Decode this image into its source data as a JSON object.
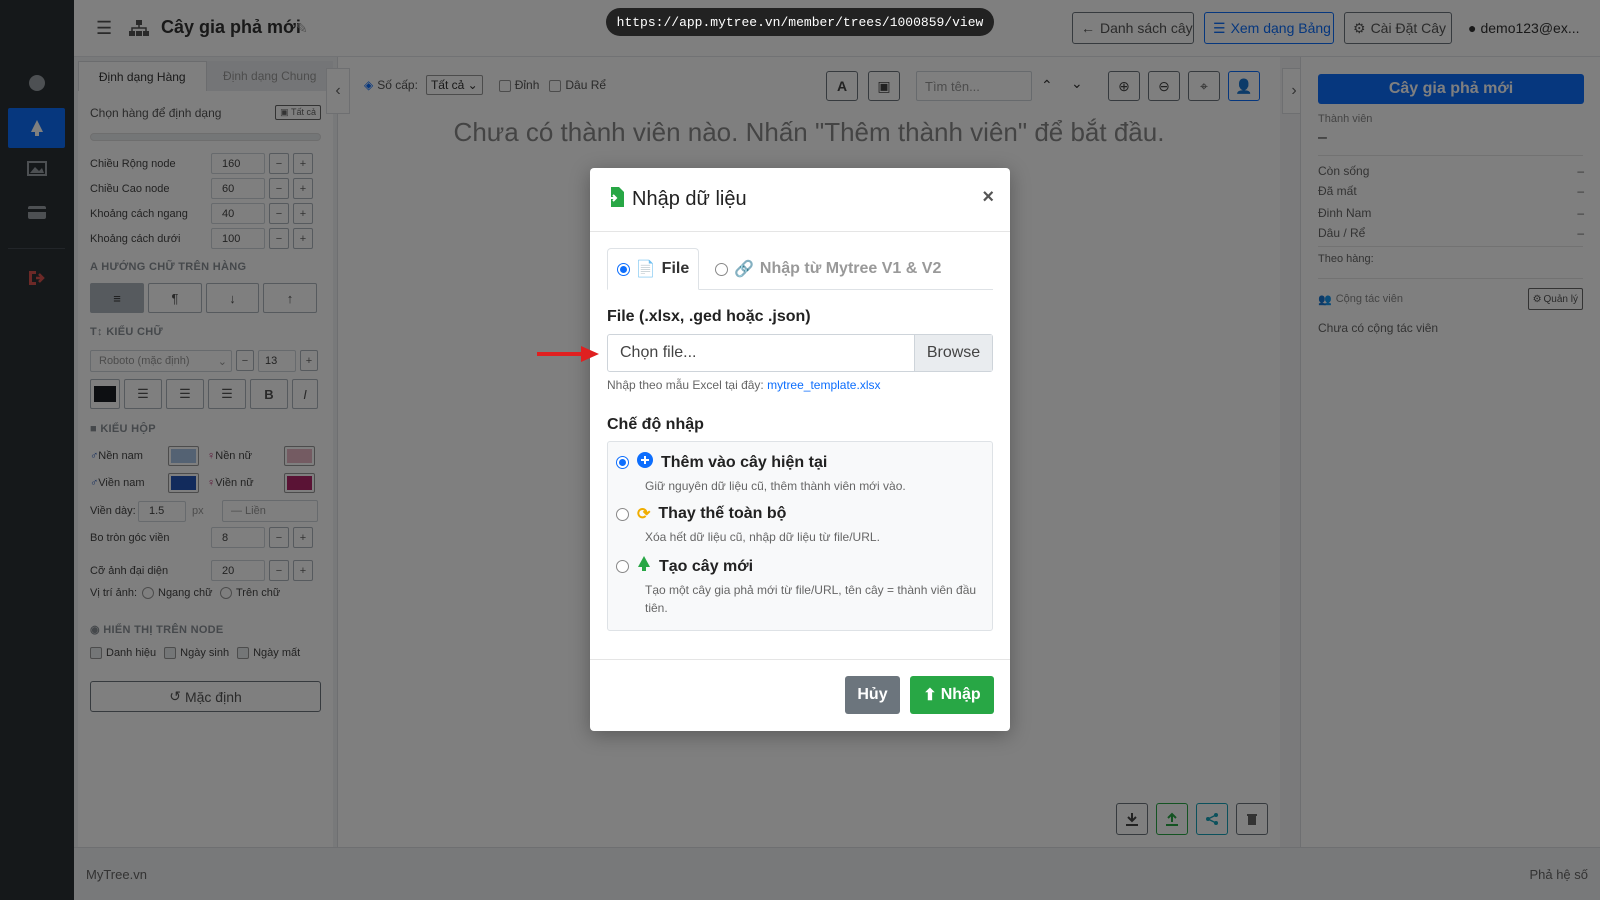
{
  "browser": {
    "url": "https://app.mytree.vn/member/trees/1000859/view"
  },
  "header": {
    "title": "Cây gia phả mới",
    "list_btn": "Danh sách cây",
    "table_btn": "Xem dạng Bảng",
    "settings_btn": "Cài Đặt Cây",
    "user": "demo123@ex..."
  },
  "left_panel": {
    "tab_row": "Định dạng Hàng",
    "tab_general": "Định dạng Chung",
    "select_row_label": "Chọn hàng để định dạng",
    "select_all_btn": "Tất cả",
    "fields": [
      {
        "label": "Chiều Rộng node",
        "value": "160"
      },
      {
        "label": "Chiều Cao node",
        "value": "60"
      },
      {
        "label": "Khoảng cách ngang",
        "value": "40"
      },
      {
        "label": "Khoảng cách dưới",
        "value": "100"
      }
    ],
    "text_dir_head": "HƯỚNG CHỮ TRÊN HÀNG",
    "font_head": "KIỂU CHỮ",
    "font_family": "Roboto (mặc định)",
    "font_size": "13",
    "font_color": "#1b1f24",
    "box_head": "KIỂU HỘP",
    "male_bg_label": "Nền nam",
    "female_bg_label": "Nền nữ",
    "male_border_label": "Viền nam",
    "female_border_label": "Viền nữ",
    "male_bg_color": "#a9c4e6",
    "female_bg_color": "#e8b6c4",
    "male_border_color": "#2456b8",
    "female_border_color": "#b5266a",
    "border_width_label": "Viền dày:",
    "border_width": "1.5",
    "border_unit": "px",
    "border_style": "— Liền",
    "radius_label": "Bo tròn góc viền",
    "radius": "8",
    "avatar_size_label": "Cỡ ảnh đại diện",
    "avatar_size": "20",
    "avatar_pos_label": "Vị trí ảnh:",
    "avatar_pos_opt1": "Ngang chữ",
    "avatar_pos_opt2": "Trên chữ",
    "display_head": "HIỂN THỊ TRÊN NODE",
    "show_title": "Danh hiệu",
    "show_birth": "Ngày sinh",
    "show_death": "Ngày mất",
    "default_btn": "Mặc định"
  },
  "canvas": {
    "levels_label": "Số cấp:",
    "levels_value": "Tất cả",
    "chk_top": "Đỉnh",
    "chk_root": "Dâu Rể",
    "search_placeholder": "Tìm tên...",
    "empty_msg": "Chưa có thành viên nào. Nhấn \"Thêm thành viên\" để bắt đầu."
  },
  "right_panel": {
    "title": "Cây gia phả mới",
    "members_label": "Thành viên",
    "members_value": "–",
    "stats": [
      {
        "label": "Còn sống",
        "value": "–"
      },
      {
        "label": "Đã mất",
        "value": "–"
      },
      {
        "label": "Đinh Nam",
        "value": "–"
      },
      {
        "label": "Dâu / Rể",
        "value": "–"
      }
    ],
    "by_row": "Theo hàng:",
    "collab_label": "Cộng tác viên",
    "manage_btn": "Quản lý",
    "no_collab": "Chưa có cộng tác viên"
  },
  "footer": {
    "left": "MyTree.vn",
    "right": "Phả hệ số"
  },
  "modal": {
    "title": "Nhập dữ liệu",
    "tab_file": "File",
    "tab_import": "Nhập từ Mytree V1 & V2",
    "file_label": "File (.xlsx, .ged hoặc .json)",
    "file_placeholder": "Chọn file...",
    "browse": "Browse",
    "hint": "Nhập theo mẫu Excel tại đây:",
    "hint_link": "mytree_template.xlsx",
    "mode_label": "Chế độ nhập",
    "options": [
      {
        "title": "Thêm vào cây hiện tại",
        "desc": "Giữ nguyên dữ liệu cũ, thêm thành viên mới vào."
      },
      {
        "title": "Thay thế toàn bộ",
        "desc": "Xóa hết dữ liệu cũ, nhập dữ liệu từ file/URL."
      },
      {
        "title": "Tạo cây mới",
        "desc": "Tạo một cây gia phả mới từ file/URL, tên cây = thành viên đầu tiên."
      }
    ],
    "cancel": "Hủy",
    "submit": "Nhập"
  }
}
